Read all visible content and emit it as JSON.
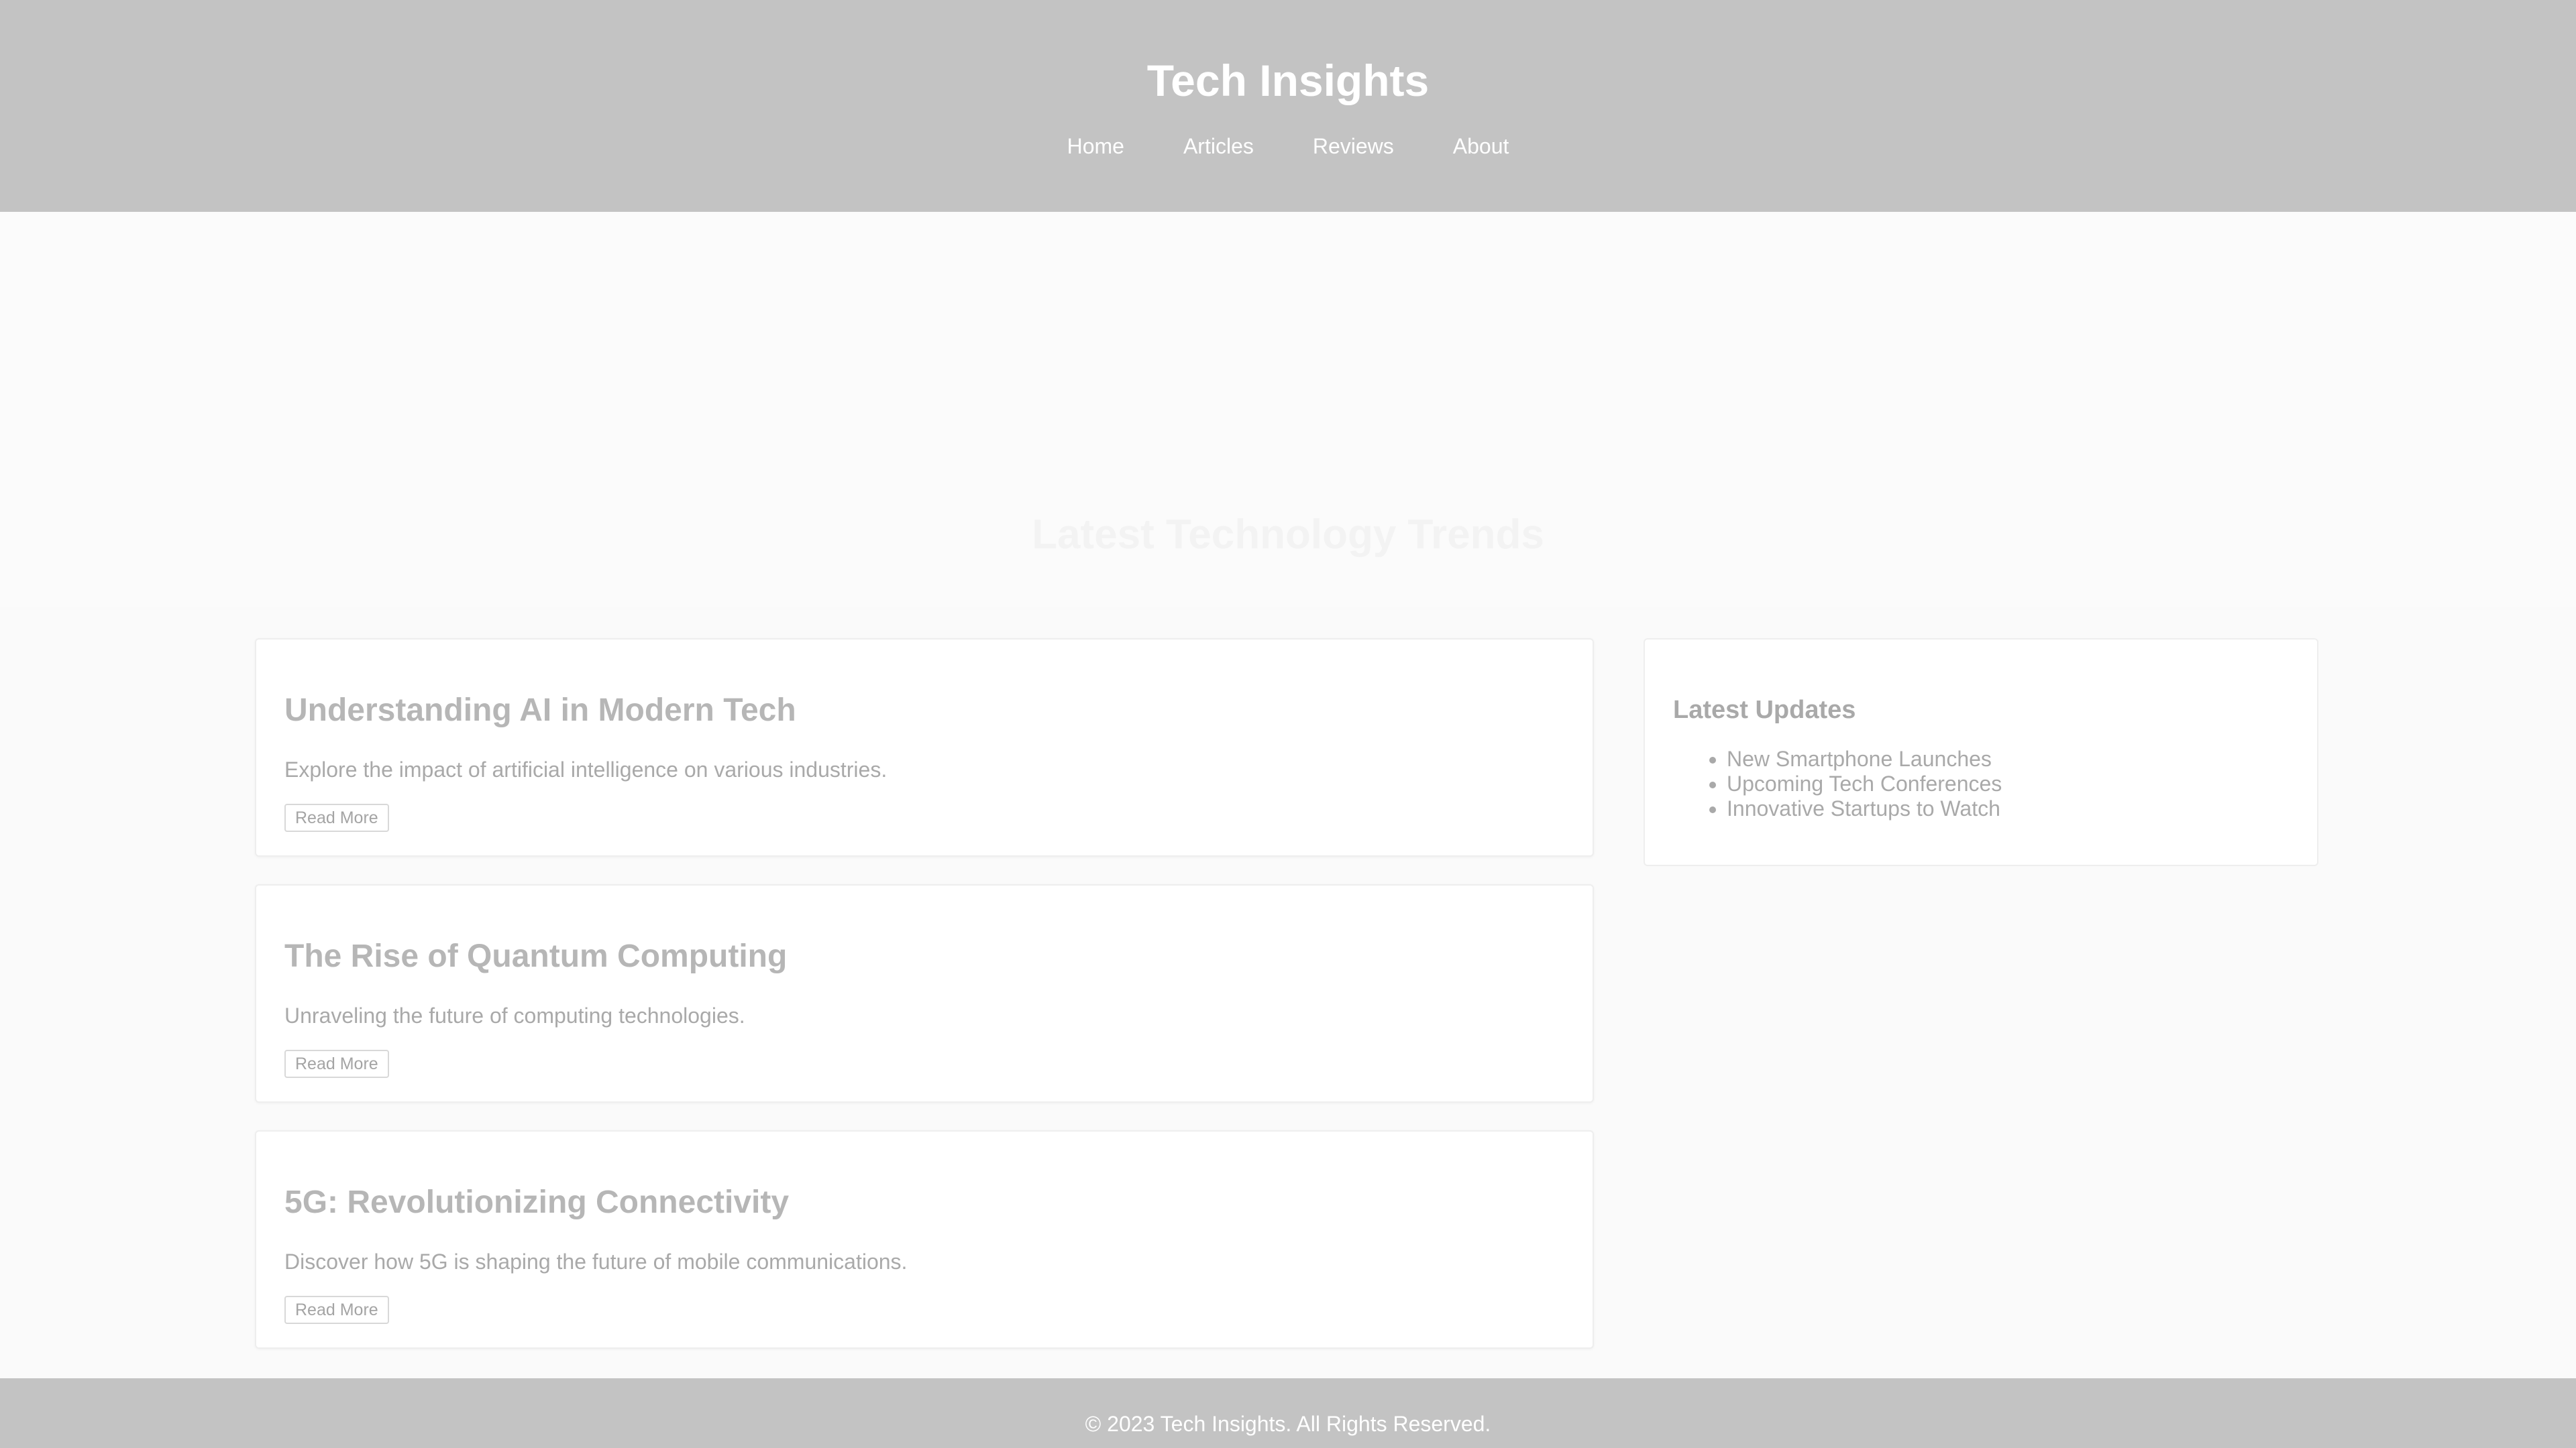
{
  "header": {
    "title": "Tech Insights",
    "nav": [
      "Home",
      "Articles",
      "Reviews",
      "About"
    ]
  },
  "hero": {
    "title": "Latest Technology Trends"
  },
  "articles": [
    {
      "title": "Understanding AI in Modern Tech",
      "description": "Explore the impact of artificial intelligence on various industries.",
      "button": "Read More"
    },
    {
      "title": "The Rise of Quantum Computing",
      "description": "Unraveling the future of computing technologies.",
      "button": "Read More"
    },
    {
      "title": "5G: Revolutionizing Connectivity",
      "description": "Discover how 5G is shaping the future of mobile communications.",
      "button": "Read More"
    }
  ],
  "sidebar": {
    "title": "Latest Updates",
    "items": [
      "New Smartphone Launches",
      "Upcoming Tech Conferences",
      "Innovative Startups to Watch"
    ]
  },
  "footer": {
    "text": "© 2023 Tech Insights. All Rights Reserved."
  },
  "colors": {
    "header_bg": "#c3c3c3",
    "page_bg": "#fafafa",
    "card_bg": "#ffffff",
    "muted_text": "#a9a9a9"
  }
}
